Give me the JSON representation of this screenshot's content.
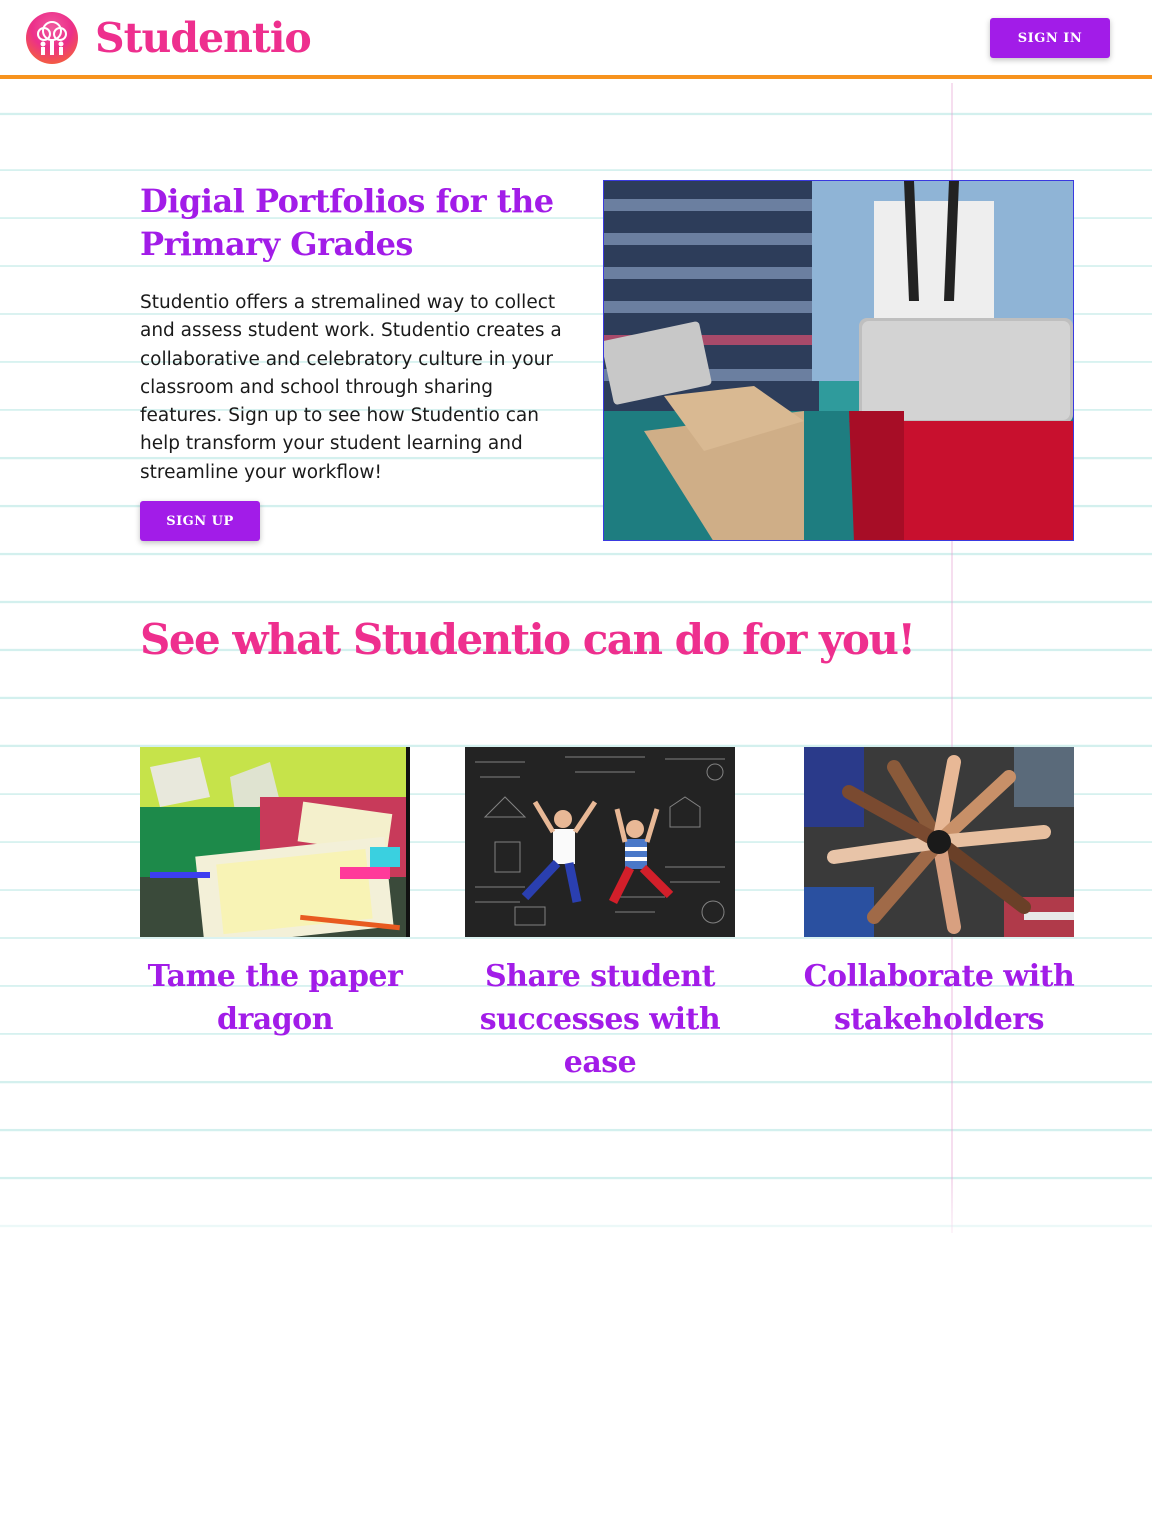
{
  "brand": {
    "name": "Studentio",
    "logo_icon": "tree-people-icon",
    "colors": {
      "pink": "#ee2f8e",
      "purple": "#a21ce8",
      "orange": "#f7931e"
    }
  },
  "header": {
    "signin_label": "SIGN IN"
  },
  "hero": {
    "title": "Digial Portfolios for the Primary Grades",
    "text": "Studentio offers a stremalined way to collect and assess student work. Studentio creates a collaborative and celebratory culture in your classroom and school through sharing features. Sign up to see how Studentio can help transform your student learning and streamline your workflow!",
    "signup_label": "SIGN UP",
    "image": "students-with-tablet-and-laptop-photo"
  },
  "features": {
    "title": "See what Studentio can do for you!",
    "items": [
      {
        "caption": "Tame the paper dragon",
        "image": "messy-desk-papers-photo"
      },
      {
        "caption": "Share student successes with ease",
        "image": "kids-on-chalkboard-photo"
      },
      {
        "caption": "Collaborate with stakeholders",
        "image": "hands-together-circle-photo"
      }
    ]
  }
}
